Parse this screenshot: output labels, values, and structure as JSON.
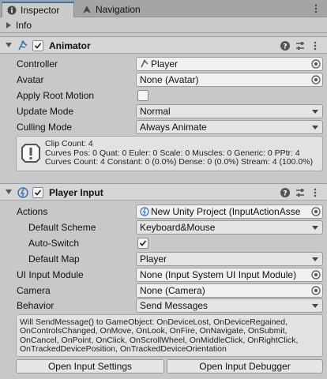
{
  "tabs": [
    {
      "label": "Inspector",
      "icon": "info-icon"
    },
    {
      "label": "Navigation",
      "icon": "navigation-icon"
    }
  ],
  "info": {
    "label": "Info"
  },
  "animator": {
    "title": "Animator",
    "rows": {
      "controller": {
        "label": "Controller",
        "value": "Player"
      },
      "avatar": {
        "label": "Avatar",
        "value": "None (Avatar)"
      },
      "apply_root_motion": {
        "label": "Apply Root Motion",
        "checked": false
      },
      "update_mode": {
        "label": "Update Mode",
        "value": "Normal"
      },
      "culling_mode": {
        "label": "Culling Mode",
        "value": "Always Animate"
      }
    },
    "stats": [
      "Clip Count: 4",
      "Curves Pos: 0 Quat: 0 Euler: 0 Scale: 0 Muscles: 0 Generic: 0 PPtr: 4",
      "Curves Count: 4 Constant: 0 (0.0%) Dense: 0 (0.0%) Stream: 4 (100.0%)"
    ]
  },
  "player_input": {
    "title": "Player Input",
    "rows": {
      "actions": {
        "label": "Actions",
        "value": "New Unity Project (InputActionAsse"
      },
      "default_scheme": {
        "label": "Default Scheme",
        "value": "Keyboard&Mouse"
      },
      "auto_switch": {
        "label": "Auto-Switch",
        "checked": true
      },
      "default_map": {
        "label": "Default Map",
        "value": "Player"
      },
      "ui_input_module": {
        "label": "UI Input Module",
        "value": "None (Input System UI Input Module)"
      },
      "camera": {
        "label": "Camera",
        "value": "None (Camera)"
      },
      "behavior": {
        "label": "Behavior",
        "value": "Send Messages"
      }
    },
    "message_lines": [
      "Will SendMessage() to GameObject: OnDeviceLost, OnDeviceRegained,",
      "OnControlsChanged, OnMove, OnLook, OnFire, OnNavigate, OnSubmit,",
      "OnCancel, OnPoint, OnClick, OnScrollWheel, OnMiddleClick, OnRightClick,",
      "OnTrackedDevicePosition, OnTrackedDeviceOrientation"
    ],
    "buttons": {
      "open_settings": "Open Input Settings",
      "open_debugger": "Open Input Debugger"
    }
  },
  "colors": {
    "accent": "#3a72b0",
    "background": "#c8c8c8",
    "header": "#d6d6d6"
  }
}
